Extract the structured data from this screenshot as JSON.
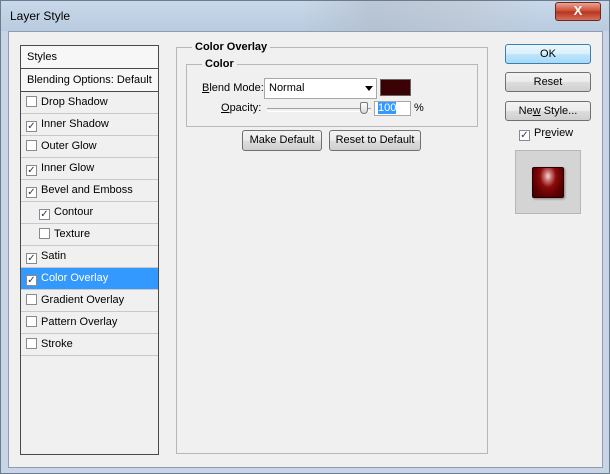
{
  "window": {
    "title": "Layer Style",
    "close_glyph": "X"
  },
  "sidebar": {
    "header": "Styles",
    "blending_options": "Blending Options: Default",
    "items": [
      {
        "label": "Drop Shadow",
        "checked": false,
        "indent": false,
        "selected": false
      },
      {
        "label": "Inner Shadow",
        "checked": true,
        "indent": false,
        "selected": false
      },
      {
        "label": "Outer Glow",
        "checked": false,
        "indent": false,
        "selected": false
      },
      {
        "label": "Inner Glow",
        "checked": true,
        "indent": false,
        "selected": false
      },
      {
        "label": "Bevel and Emboss",
        "checked": true,
        "indent": false,
        "selected": false
      },
      {
        "label": "Contour",
        "checked": true,
        "indent": true,
        "selected": false
      },
      {
        "label": "Texture",
        "checked": false,
        "indent": true,
        "selected": false
      },
      {
        "label": "Satin",
        "checked": true,
        "indent": false,
        "selected": false
      },
      {
        "label": "Color Overlay",
        "checked": true,
        "indent": false,
        "selected": true
      },
      {
        "label": "Gradient Overlay",
        "checked": false,
        "indent": false,
        "selected": false
      },
      {
        "label": "Pattern Overlay",
        "checked": false,
        "indent": false,
        "selected": false
      },
      {
        "label": "Stroke",
        "checked": false,
        "indent": false,
        "selected": false
      }
    ]
  },
  "panel": {
    "title": "Color Overlay",
    "group_title": "Color",
    "blend_mode_label": "Blend Mode:",
    "blend_mode_value": "Normal",
    "overlay_color": "#3a0204",
    "opacity_label": "Opacity:",
    "opacity_value": "100",
    "opacity_unit": "%",
    "opacity_level_percent": 100,
    "make_default": "Make Default",
    "reset_to_default": "Reset to Default"
  },
  "actions": {
    "ok": "OK",
    "reset": "Reset",
    "new_style": "New Style...",
    "preview_label": "Preview",
    "preview_checked": true
  },
  "colors": {
    "selection": "#3399ff",
    "title_bar": "#c9d8ea",
    "close_button": "#c8482f"
  }
}
